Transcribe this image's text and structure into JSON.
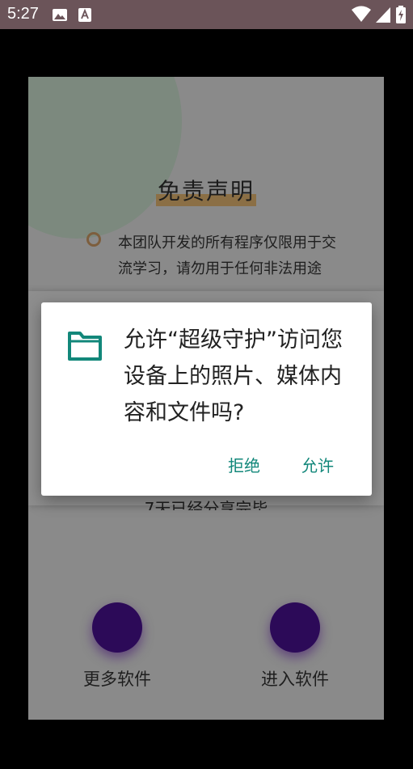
{
  "status_bar": {
    "time": "5:27",
    "icons": [
      "photo-icon",
      "font-a-icon",
      "wifi-icon",
      "signal-icon",
      "battery-charging-icon"
    ],
    "background": "#6b5459"
  },
  "card": {
    "title": "免责声明",
    "body_text": "本团队开发的所有程序仅限用于交流学习，请勿用于任何非法用途",
    "partial_text": "7天已经分享完毕",
    "buttons": {
      "more_label": "更多软件",
      "enter_label": "进入软件"
    },
    "accent_color": "#f0a944",
    "button_color": "#4b0b9b"
  },
  "dialog": {
    "icon": "folder-icon",
    "message": "允许“超级守护”访问您设备上的照片、媒体内容和文件吗?",
    "deny_label": "拒绝",
    "allow_label": "允许",
    "accent_color": "#12877a"
  }
}
